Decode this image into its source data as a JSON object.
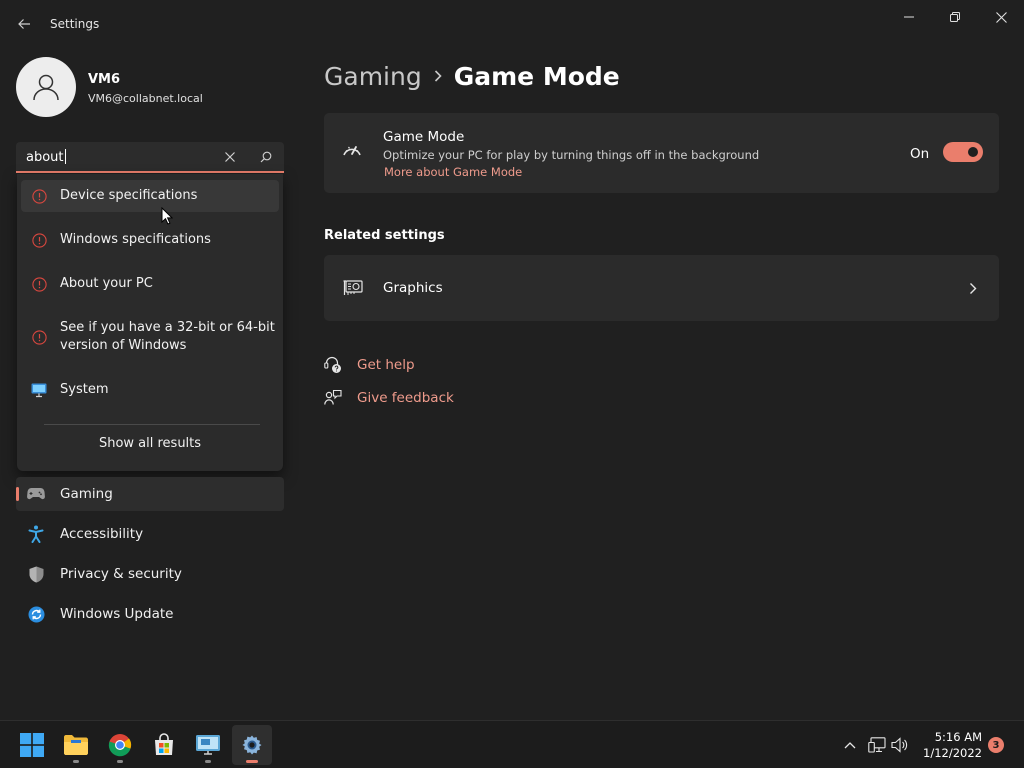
{
  "window": {
    "title": "Settings"
  },
  "profile": {
    "name": "VM6",
    "email": "VM6@collabnet.local"
  },
  "search": {
    "value": "about",
    "results": [
      {
        "label": "Device specifications",
        "icon": "info-icon"
      },
      {
        "label": "Windows specifications",
        "icon": "info-icon"
      },
      {
        "label": "About your PC",
        "icon": "info-icon"
      },
      {
        "label": "See if you have a 32-bit or 64-bit version of Windows",
        "icon": "info-icon"
      },
      {
        "label": "System",
        "icon": "monitor-icon"
      }
    ],
    "show_all_label": "Show all results"
  },
  "nav": {
    "items": [
      {
        "label": "Gaming",
        "icon": "gamepad-icon",
        "active": true
      },
      {
        "label": "Accessibility",
        "icon": "accessibility-icon"
      },
      {
        "label": "Privacy & security",
        "icon": "shield-icon"
      },
      {
        "label": "Windows Update",
        "icon": "update-icon"
      }
    ]
  },
  "breadcrumb": {
    "parent": "Gaming",
    "current": "Game Mode"
  },
  "game_mode": {
    "title": "Game Mode",
    "description": "Optimize your PC for play by turning things off in the background",
    "link": "More about Game Mode",
    "state_label": "On",
    "enabled": true
  },
  "related": {
    "heading": "Related settings",
    "items": [
      {
        "label": "Graphics",
        "icon": "graphics-card-icon"
      }
    ]
  },
  "help": {
    "get_help": "Get help",
    "give_feedback": "Give feedback"
  },
  "taskbar": {
    "time": "5:16 AM",
    "date": "1/12/2022",
    "notification_count": "3"
  },
  "colors": {
    "accent": "#ea7e6c",
    "link": "#ef9b8c",
    "background": "#202020",
    "card": "#2b2b2b",
    "info_icon": "#d9473f"
  }
}
